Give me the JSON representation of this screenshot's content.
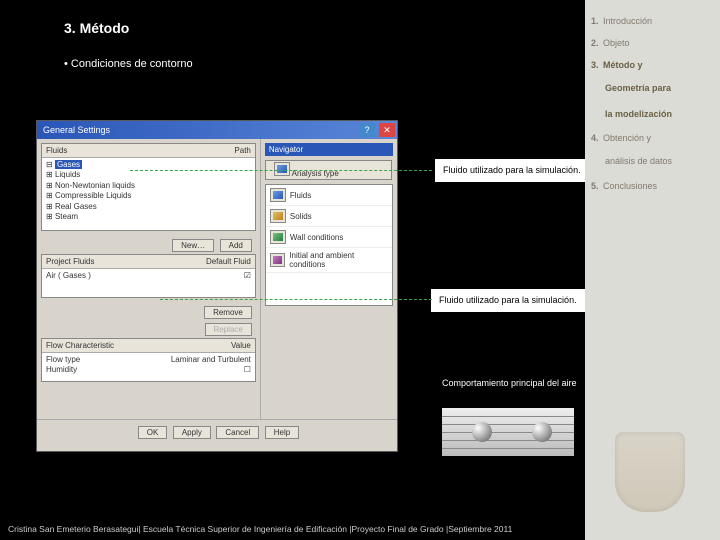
{
  "title": "3. Método",
  "subtitle": "• Condiciones de contorno",
  "footer": "Cristina San Emeterio Berasategui| Escuela Técnica Superior de Ingeniería de Edificación |Proyecto Final de Grado |Septiembre 2011",
  "toc": [
    {
      "num": "1.",
      "label": "Introducción",
      "current": false
    },
    {
      "num": "2.",
      "label": "Objeto",
      "current": false
    },
    {
      "num": "3.",
      "label": "Método y",
      "current": true,
      "sub": [
        "Geometría para",
        "la modelización"
      ]
    },
    {
      "num": "4.",
      "label": "Obtención y",
      "current": false,
      "sub": [
        "análisis de datos"
      ]
    },
    {
      "num": "5.",
      "label": "Conclusiones",
      "current": false
    }
  ],
  "dialog": {
    "title": "General Settings",
    "close": "✕",
    "help_btn": "?",
    "fluids_header": {
      "col1": "Fluids",
      "col2": "Path"
    },
    "fluids_tree": [
      "Gases",
      "Liquids",
      "Non-Newtonian liquids",
      "Compressible Liquids",
      "Real Gases",
      "Steam"
    ],
    "new_btn": "New…",
    "project_header": {
      "col1": "Project Fluids",
      "col2": "Default Fluid"
    },
    "project_fluid": "Air ( Gases )",
    "add_btn": "Add",
    "remove_btn": "Remove",
    "replace_btn": "Replace",
    "flow_header": {
      "col1": "Flow Characteristic",
      "col2": "Value"
    },
    "flow_rows": [
      {
        "k": "Flow type",
        "v": "Laminar and Turbulent"
      },
      {
        "k": "Humidity",
        "v": ""
      }
    ],
    "main_btns": [
      "OK",
      "Apply",
      "Cancel",
      "Help"
    ],
    "nav_title": "Navigator",
    "nav_btn": "Analysis type",
    "nav_items": [
      "Fluids",
      "Solids",
      "Wall conditions",
      "Initial and ambient conditions"
    ]
  },
  "callout1": "Fluido utilizado para la simulación.",
  "callout2": "Fluido utilizado para la simulación.",
  "caption": "Comportamiento principal del aire"
}
